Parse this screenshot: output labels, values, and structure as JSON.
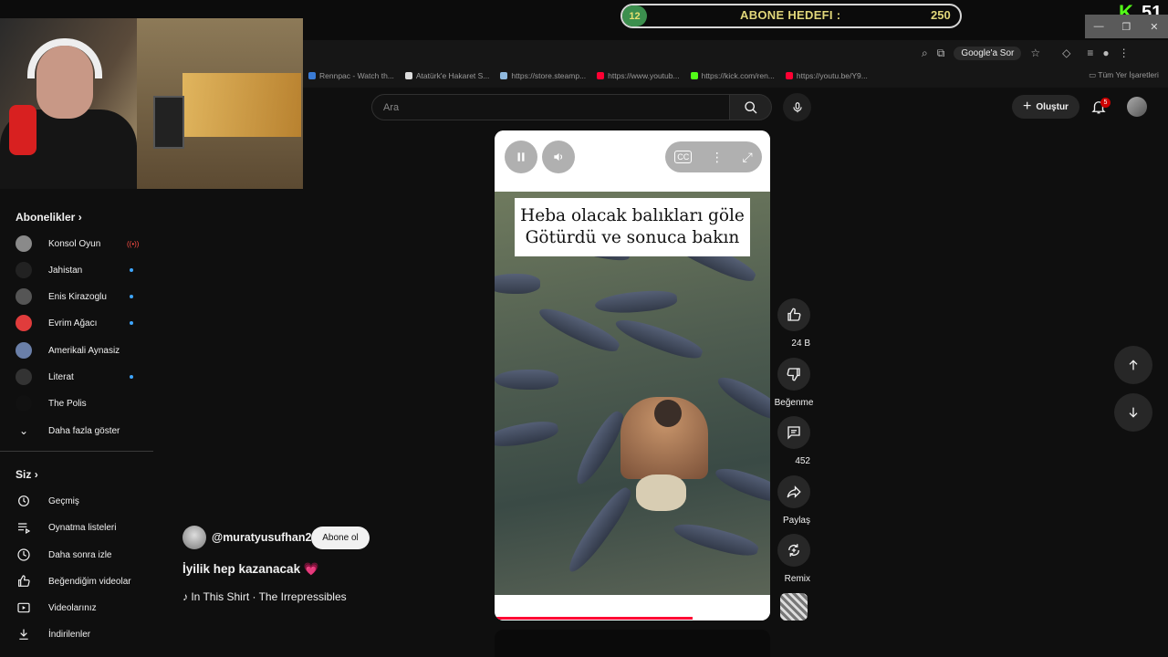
{
  "overlay": {
    "goal_badge": "12",
    "goal_label": "ABONE HEDEFI :",
    "goal_value": "250",
    "kick_viewers": "51",
    "kick_logo": "K"
  },
  "browser": {
    "ask_google": "Google'a Sor",
    "bookmarks": [
      {
        "label": "Rennpac - Watch th...",
        "color": "#3a7bd5"
      },
      {
        "label": "Atatürk'e Hakaret S...",
        "color": "#dddddd"
      },
      {
        "label": "https://store.steamp...",
        "color": "#8fb8de"
      },
      {
        "label": "https://www.youtub...",
        "color": "#ff0033"
      },
      {
        "label": "https://kick.com/ren...",
        "color": "#53fc18"
      },
      {
        "label": "https://youtu.be/Y9...",
        "color": "#ff0033"
      }
    ],
    "all_bookmarks": "Tüm Yer İşaretleri"
  },
  "header": {
    "search_placeholder": "Ara",
    "create_label": "Oluştur",
    "notif_count": "5"
  },
  "sidebar": {
    "subs_title": "Abonelikler",
    "subs": [
      {
        "label": "Konsol Oyun",
        "status": "live",
        "color": "#8a8a8a"
      },
      {
        "label": "Jahistan",
        "status": "dot",
        "color": "#222222"
      },
      {
        "label": "Enis Kirazoglu",
        "status": "dot",
        "color": "#555555"
      },
      {
        "label": "Evrim Ağacı",
        "status": "dot",
        "color": "#e03c3c"
      },
      {
        "label": "Amerikali Aynasiz",
        "status": "none",
        "color": "#6a7fa8"
      },
      {
        "label": "Literat",
        "status": "dot",
        "color": "#333333"
      },
      {
        "label": "The Polis",
        "status": "none",
        "color": "#111111"
      }
    ],
    "show_more": "Daha fazla göster",
    "you_title": "Siz",
    "you_items": [
      {
        "label": "Geçmiş",
        "icon": "history-icon"
      },
      {
        "label": "Oynatma listeleri",
        "icon": "playlist-icon"
      },
      {
        "label": "Daha sonra izle",
        "icon": "clock-icon"
      },
      {
        "label": "Beğendiğim videolar",
        "icon": "thumbs-up-icon"
      },
      {
        "label": "Videolarınız",
        "icon": "video-icon"
      },
      {
        "label": "İndirilenler",
        "icon": "download-icon"
      }
    ]
  },
  "video": {
    "caption_line1": "Heba olacak balıkları göle",
    "caption_line2": "Götürdü ve sonuca bakın",
    "progress": 0.72
  },
  "actions": {
    "likes": "24 B",
    "dislike": "Beğenme",
    "comments": "452",
    "share": "Paylaş",
    "remix": "Remix"
  },
  "channel": {
    "handle": "@muratyusufhan23",
    "subscribe": "Abone ol",
    "title": "İyilik hep kazanacak 💗",
    "music_note": "♪",
    "music": "In This Shirt · The Irrepressibles"
  }
}
